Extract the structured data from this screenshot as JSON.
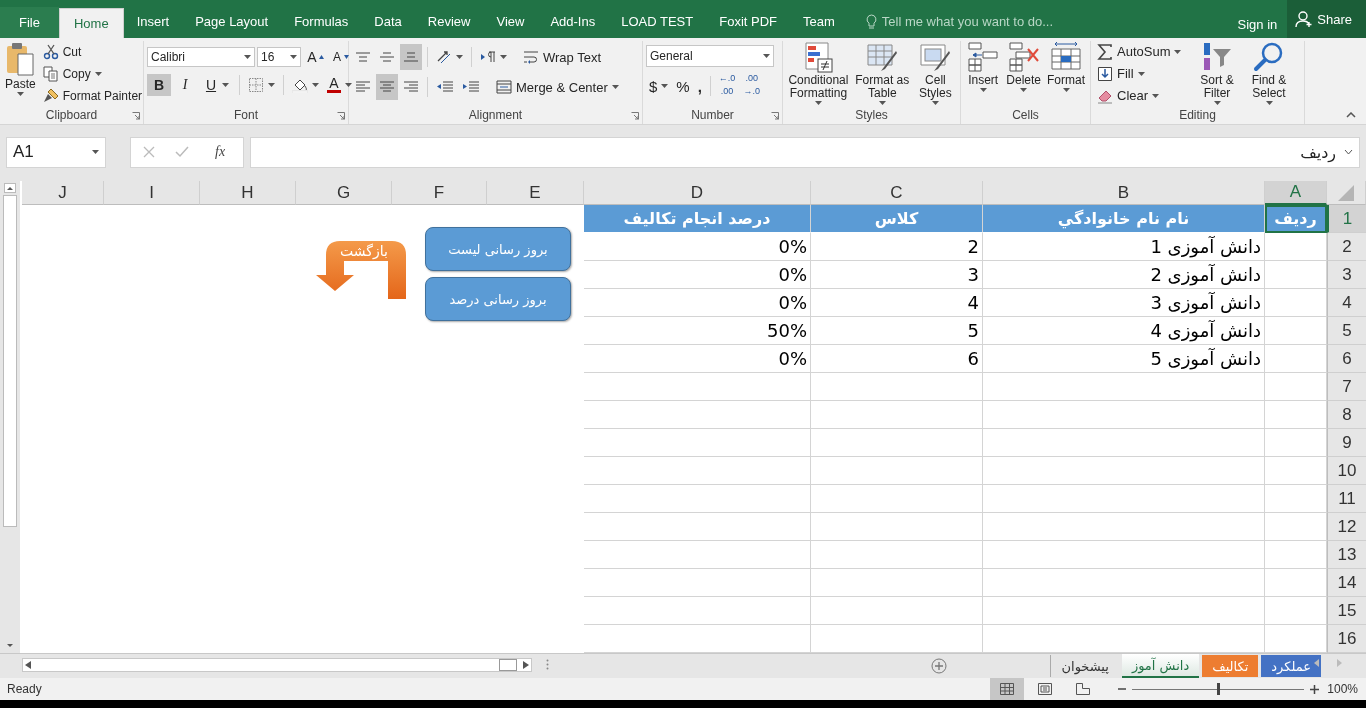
{
  "ribbon_tabs": [
    {
      "label": "File",
      "kind": "file",
      "selected": false
    },
    {
      "label": "Home",
      "kind": "tab",
      "selected": true
    },
    {
      "label": "Insert",
      "kind": "tab",
      "selected": false
    },
    {
      "label": "Page Layout",
      "kind": "tab",
      "selected": false
    },
    {
      "label": "Formulas",
      "kind": "tab",
      "selected": false
    },
    {
      "label": "Data",
      "kind": "tab",
      "selected": false
    },
    {
      "label": "Review",
      "kind": "tab",
      "selected": false
    },
    {
      "label": "View",
      "kind": "tab",
      "selected": false
    },
    {
      "label": "Add-Ins",
      "kind": "tab",
      "selected": false
    },
    {
      "label": "LOAD TEST",
      "kind": "tab",
      "selected": false
    },
    {
      "label": "Foxit PDF",
      "kind": "tab",
      "selected": false
    },
    {
      "label": "Team",
      "kind": "tab",
      "selected": false
    }
  ],
  "tell_me": {
    "placeholder": "Tell me what you want to do..."
  },
  "account": {
    "sign_in": "Sign in",
    "share": "Share"
  },
  "clipboard": {
    "label": "Clipboard",
    "paste": "Paste",
    "cut": "Cut",
    "copy": "Copy",
    "format_painter": "Format Painter"
  },
  "font": {
    "label": "Font",
    "font_name": "Calibri",
    "font_size": "16",
    "grow": "A",
    "shrink": "A",
    "font_color": "A",
    "styles": [
      {
        "label": "B",
        "kind": "bold",
        "on": true
      },
      {
        "label": "I",
        "kind": "italic",
        "on": false
      },
      {
        "label": "U",
        "kind": "underline",
        "on": false
      }
    ]
  },
  "alignment": {
    "label": "Alignment",
    "wrap_text": "Wrap Text",
    "merge_center": "Merge & Center",
    "vertical": [
      {
        "kind": "top",
        "selected": false
      },
      {
        "kind": "middle",
        "selected": false
      },
      {
        "kind": "bottom",
        "selected": true
      }
    ],
    "horizontal": [
      {
        "kind": "left",
        "selected": false
      },
      {
        "kind": "center",
        "selected": true
      },
      {
        "kind": "right",
        "selected": false
      }
    ]
  },
  "number": {
    "label": "Number",
    "format": "General",
    "currency": "$",
    "percent": "%",
    "comma": ",",
    "decimals": [
      {
        "top": "←.0",
        "bottom": ".00"
      },
      {
        "top": ".00",
        "bottom": "→.0"
      }
    ]
  },
  "styles": {
    "label": "Styles",
    "buttons": [
      {
        "label": "Conditional Formatting",
        "kind": "conditional"
      },
      {
        "label": "Format as Table",
        "kind": "table"
      },
      {
        "label": "Cell Styles",
        "kind": "cellstyles"
      }
    ]
  },
  "cells": {
    "label": "Cells",
    "buttons": [
      {
        "label": "Insert",
        "kind": "insert"
      },
      {
        "label": "Delete",
        "kind": "delete"
      },
      {
        "label": "Format",
        "kind": "format"
      }
    ]
  },
  "editing": {
    "label": "Editing",
    "small": [
      {
        "label": "AutoSum",
        "kind": "sum"
      },
      {
        "label": "Fill",
        "kind": "fill"
      },
      {
        "label": "Clear",
        "kind": "clear"
      }
    ],
    "big": [
      {
        "label": "Sort & Filter",
        "kind": "sort"
      },
      {
        "label": "Find & Select",
        "kind": "find"
      }
    ]
  },
  "formula_bar": {
    "name_box": "A1",
    "function_button": "fx",
    "value": "ردیف"
  },
  "sheet": {
    "columns": [
      {
        "label": "J",
        "selected": false
      },
      {
        "label": "I",
        "selected": false
      },
      {
        "label": "H",
        "selected": false
      },
      {
        "label": "G",
        "selected": false
      },
      {
        "label": "F",
        "selected": false
      },
      {
        "label": "E",
        "selected": false
      },
      {
        "label": "D",
        "selected": false
      },
      {
        "label": "C",
        "selected": false
      },
      {
        "label": "B",
        "selected": false
      },
      {
        "label": "A",
        "selected": true
      }
    ],
    "row_headers": [
      {
        "label": "1",
        "selected": true
      },
      {
        "label": "2",
        "selected": false
      },
      {
        "label": "3",
        "selected": false
      },
      {
        "label": "4",
        "selected": false
      },
      {
        "label": "5",
        "selected": false
      },
      {
        "label": "6",
        "selected": false
      },
      {
        "label": "7",
        "selected": false
      },
      {
        "label": "8",
        "selected": false
      },
      {
        "label": "9",
        "selected": false
      },
      {
        "label": "10",
        "selected": false
      },
      {
        "label": "11",
        "selected": false
      },
      {
        "label": "12",
        "selected": false
      },
      {
        "label": "13",
        "selected": false
      },
      {
        "label": "14",
        "selected": false
      },
      {
        "label": "15",
        "selected": false
      },
      {
        "label": "16",
        "selected": false
      }
    ],
    "rows": [
      {
        "kind": "header",
        "cells": [
          "",
          "",
          "",
          "",
          "",
          "",
          {
            "text": "درصد انجام تکالیف",
            "selected": false
          },
          {
            "text": "کلاس",
            "selected": false
          },
          {
            "text": "نام نام خانوادگي",
            "selected": false
          },
          {
            "text": "ردیف",
            "selected": true
          }
        ]
      },
      {
        "kind": "data",
        "cells": [
          "",
          "",
          "",
          "",
          "",
          "",
          {
            "text": "0%",
            "selected": false
          },
          {
            "text": "2",
            "selected": false
          },
          {
            "text": "دانش آموزی 1",
            "selected": false
          },
          {
            "selected": false
          }
        ]
      },
      {
        "kind": "data",
        "cells": [
          "",
          "",
          "",
          "",
          "",
          "",
          {
            "text": "0%",
            "selected": false
          },
          {
            "text": "3",
            "selected": false
          },
          {
            "text": "دانش آموزی 2",
            "selected": false
          },
          {
            "selected": false
          }
        ]
      },
      {
        "kind": "data",
        "cells": [
          "",
          "",
          "",
          "",
          "",
          "",
          {
            "text": "0%",
            "selected": false
          },
          {
            "text": "4",
            "selected": false
          },
          {
            "text": "دانش آموزی 3",
            "selected": false
          },
          {
            "selected": false
          }
        ]
      },
      {
        "kind": "data",
        "cells": [
          "",
          "",
          "",
          "",
          "",
          "",
          {
            "text": "50%",
            "selected": false
          },
          {
            "text": "5",
            "selected": false
          },
          {
            "text": "دانش آموزی 4",
            "selected": false
          },
          {
            "selected": false
          }
        ]
      },
      {
        "kind": "data",
        "cells": [
          "",
          "",
          "",
          "",
          "",
          "",
          {
            "text": "0%",
            "selected": false
          },
          {
            "text": "6",
            "selected": false
          },
          {
            "text": "دانش آموزی 5",
            "selected": false
          },
          {
            "selected": false
          }
        ]
      }
    ],
    "shapes": [
      {
        "kind": "button",
        "label": "بروز رسانی لیست"
      },
      {
        "kind": "button",
        "label": "بروز رسانی درصد"
      },
      {
        "kind": "arrow",
        "label": "بازگشت"
      }
    ]
  },
  "sheet_tabs": [
    {
      "label": "عملکرد",
      "color": "#4472c4",
      "selected": false
    },
    {
      "label": "تکالیف",
      "color": "#ed7d31",
      "selected": false
    },
    {
      "label": "دانش آموز",
      "selected": true
    },
    {
      "label": "پیشخوان",
      "selected": false
    }
  ],
  "status_bar": {
    "status": "Ready",
    "views": [
      {
        "kind": "normal",
        "selected": true
      },
      {
        "kind": "layout",
        "selected": false
      },
      {
        "kind": "break",
        "selected": false
      }
    ],
    "zoom": {
      "level": 0.5,
      "reading": "100%"
    }
  }
}
